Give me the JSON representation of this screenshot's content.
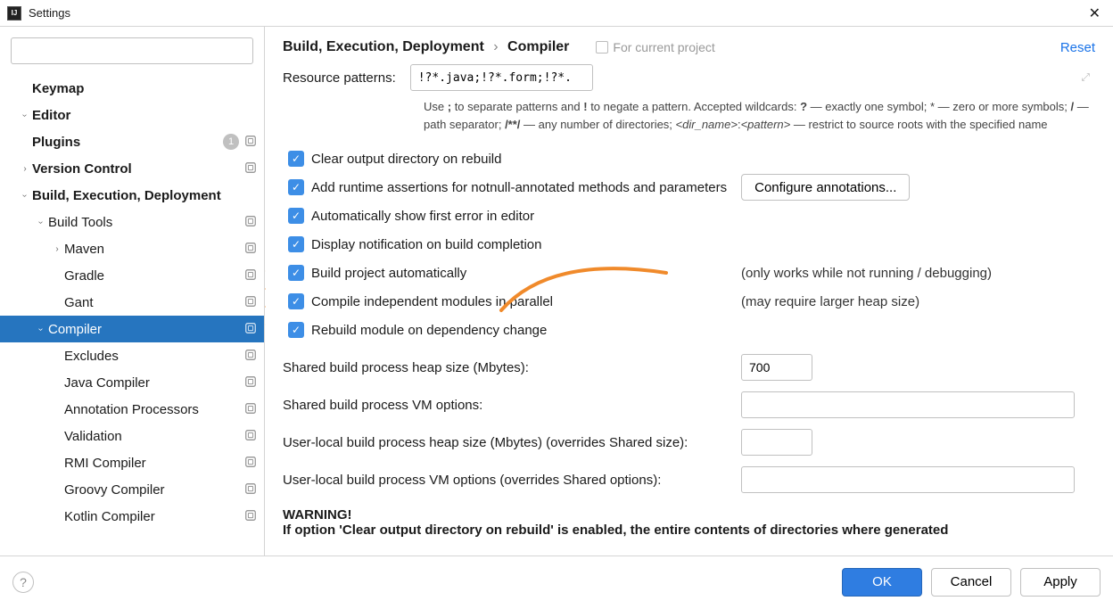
{
  "titlebar": {
    "title": "Settings"
  },
  "sidebar": {
    "search_placeholder": "",
    "items": [
      {
        "label": "Keymap",
        "bold": true,
        "indent": 0,
        "expandable": false
      },
      {
        "label": "Editor",
        "bold": true,
        "indent": 0,
        "expandable": true,
        "open": true
      },
      {
        "label": "Plugins",
        "bold": true,
        "indent": 0,
        "expandable": false,
        "badge": "1",
        "proj": true
      },
      {
        "label": "Version Control",
        "bold": true,
        "indent": 0,
        "expandable": true,
        "open": false,
        "proj": true
      },
      {
        "label": "Build, Execution, Deployment",
        "bold": true,
        "indent": 0,
        "expandable": true,
        "open": true
      },
      {
        "label": "Build Tools",
        "bold": false,
        "indent": 1,
        "expandable": true,
        "open": true,
        "proj": true
      },
      {
        "label": "Maven",
        "bold": false,
        "indent": 2,
        "expandable": true,
        "open": false,
        "proj": true
      },
      {
        "label": "Gradle",
        "bold": false,
        "indent": 2,
        "expandable": false,
        "proj": true
      },
      {
        "label": "Gant",
        "bold": false,
        "indent": 2,
        "expandable": false,
        "proj": true
      },
      {
        "label": "Compiler",
        "bold": false,
        "indent": 1,
        "expandable": true,
        "open": true,
        "proj": true,
        "selected": true
      },
      {
        "label": "Excludes",
        "bold": false,
        "indent": 2,
        "expandable": false,
        "proj": true
      },
      {
        "label": "Java Compiler",
        "bold": false,
        "indent": 2,
        "expandable": false,
        "proj": true
      },
      {
        "label": "Annotation Processors",
        "bold": false,
        "indent": 2,
        "expandable": false,
        "proj": true
      },
      {
        "label": "Validation",
        "bold": false,
        "indent": 2,
        "expandable": false,
        "proj": true
      },
      {
        "label": "RMI Compiler",
        "bold": false,
        "indent": 2,
        "expandable": false,
        "proj": true
      },
      {
        "label": "Groovy Compiler",
        "bold": false,
        "indent": 2,
        "expandable": false,
        "proj": true
      },
      {
        "label": "Kotlin Compiler",
        "bold": false,
        "indent": 2,
        "expandable": false,
        "proj": true
      }
    ]
  },
  "header": {
    "crumb1": "Build, Execution, Deployment",
    "crumb2": "Compiler",
    "scope": "For current project",
    "reset": "Reset"
  },
  "patterns": {
    "label": "Resource patterns:",
    "value": "!?*.java;!?*.form;!?*.class;!?*.groovy;!?*.scala;!?*.flex;!?*.kt;!?*.clj;!?*.aj",
    "help": "Use ; to separate patterns and ! to negate a pattern. Accepted wildcards: ? — exactly one symbol; * — zero or more symbols; / — path separator; /**/ — any number of directories; <dir_name>:<pattern> — restrict to source roots with the specified name"
  },
  "checks": {
    "c1": "Clear output directory on rebuild",
    "c2": "Add runtime assertions for notnull-annotated methods and parameters",
    "c2btn": "Configure annotations...",
    "c3": "Automatically show first error in editor",
    "c4": "Display notification on build completion",
    "c5": "Build project automatically",
    "c5note": "(only works while not running / debugging)",
    "c6": "Compile independent modules in parallel",
    "c6note": "(may require larger heap size)",
    "c7": "Rebuild module on dependency change"
  },
  "form": {
    "f1": "Shared build process heap size (Mbytes):",
    "f1v": "700",
    "f2": "Shared build process VM options:",
    "f2v": "",
    "f3": "User-local build process heap size (Mbytes) (overrides Shared size):",
    "f3v": "",
    "f4": "User-local build process VM options (overrides Shared options):",
    "f4v": ""
  },
  "warning": {
    "title": "WARNING!",
    "line": "If option 'Clear output directory on rebuild' is enabled, the entire contents of directories where generated"
  },
  "footer": {
    "ok": "OK",
    "cancel": "Cancel",
    "apply": "Apply"
  }
}
